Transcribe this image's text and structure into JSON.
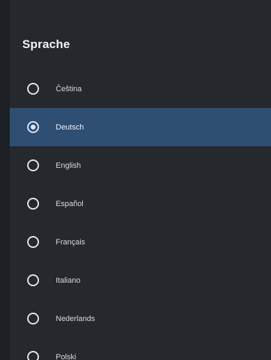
{
  "dialog": {
    "title": "Sprache",
    "items": [
      {
        "label": "Čeština",
        "selected": false
      },
      {
        "label": "Deutsch",
        "selected": true
      },
      {
        "label": "English",
        "selected": false
      },
      {
        "label": "Español",
        "selected": false
      },
      {
        "label": "Français",
        "selected": false
      },
      {
        "label": "Italiano",
        "selected": false
      },
      {
        "label": "Nederlands",
        "selected": false
      },
      {
        "label": "Polski",
        "selected": false
      }
    ]
  },
  "colors": {
    "background": "#25282d",
    "selected_row": "#2f4f72",
    "text": "#d9dbe0"
  }
}
